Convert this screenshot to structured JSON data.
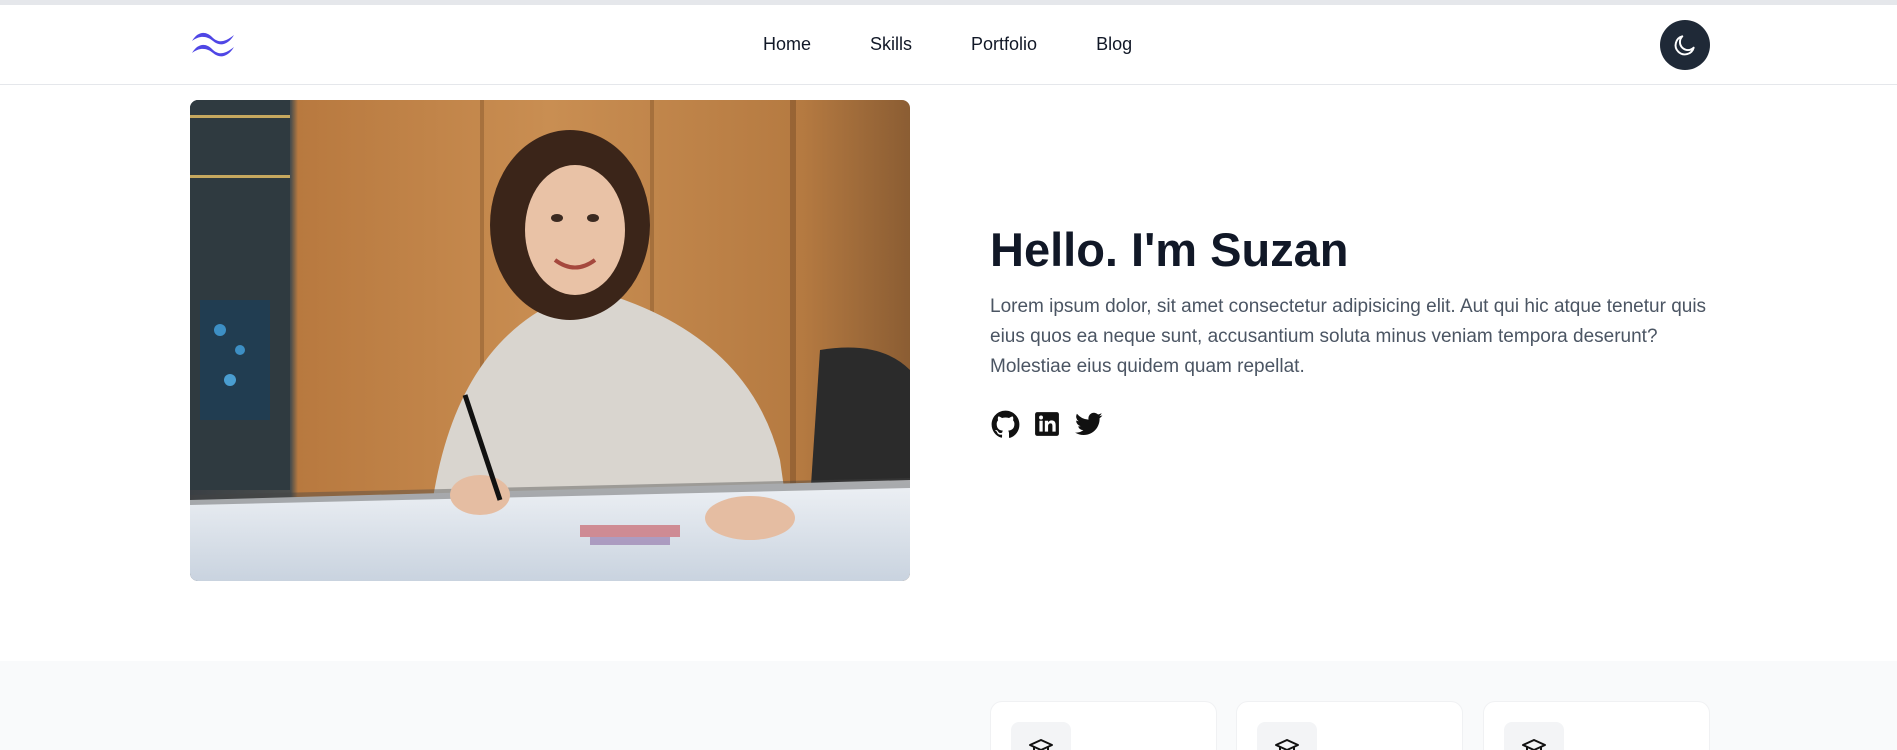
{
  "nav": {
    "logo_icon": "tailwind-wave-logo",
    "links": [
      "Home",
      "Skills",
      "Portfolio",
      "Blog"
    ],
    "theme_toggle_icon": "moon-icon"
  },
  "hero": {
    "image_alt": "Woman smiling at desk with drawings",
    "title": "Hello. I'm Suzan",
    "description": "Lorem ipsum dolor, sit amet consectetur adipisicing elit. Aut qui hic atque tenetur quis eius quos ea neque sunt, accusantium soluta minus veniam tempora deserunt? Molestiae eius quidem quam repellat.",
    "socials": [
      "github-icon",
      "linkedin-icon",
      "twitter-icon"
    ]
  },
  "features": {
    "card_icons": [
      "graduation-cap-icon",
      "graduation-cap-icon",
      "graduation-cap-icon"
    ]
  },
  "colors": {
    "accent": "#4f46e5",
    "dark": "#1f2937",
    "text_muted": "#4b5563"
  }
}
